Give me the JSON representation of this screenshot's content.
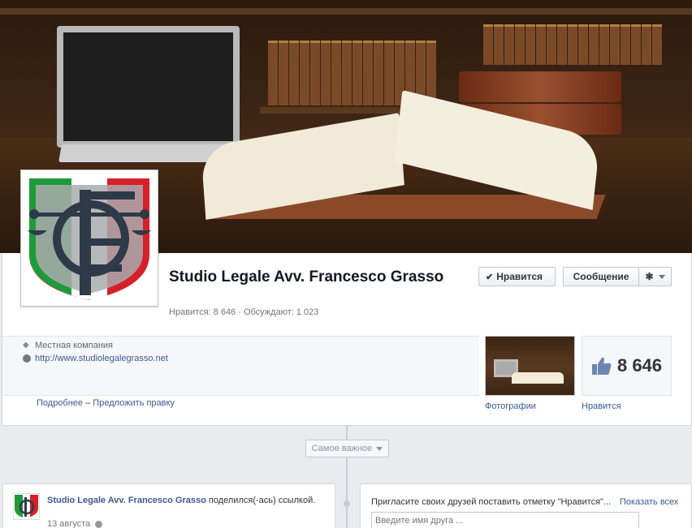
{
  "page": {
    "name": "Studio Legale Avv. Francesco Grasso",
    "stats": "Нравится: 8 646 · Обсуждают: 1 023"
  },
  "actions": {
    "like_label": "Нравится",
    "message_label": "Сообщение"
  },
  "about": {
    "category": "Местная компания",
    "website": "http://www.studiolegalegrasso.net",
    "more_link": "Подробнее",
    "separator": "–",
    "suggest_link": "Предложить правку"
  },
  "apps": {
    "photos_label": "Фотографии",
    "likes_label": "Нравится",
    "likes_count": "8 646"
  },
  "timeline": {
    "highlights_label": "Самое важное"
  },
  "post": {
    "author": "Studio Legale Avv. Francesco Grasso",
    "action_text": " поделился(-ась) ссылкой.",
    "date": "13 августа"
  },
  "invite": {
    "text": "Пригласите своих друзей поставить отметку \"Нравится\"...",
    "show_all": "Показать всех",
    "input_placeholder": "Введите имя друга ..."
  },
  "colors": {
    "link": "#3b5998",
    "logo_green": "#1f9a3a",
    "logo_red": "#d6202a",
    "logo_dark": "#2e3a48"
  },
  "icons": [
    "tag-icon",
    "globe-icon",
    "check-icon",
    "gear-icon",
    "thumbs-up-icon",
    "chevron-down-icon"
  ]
}
